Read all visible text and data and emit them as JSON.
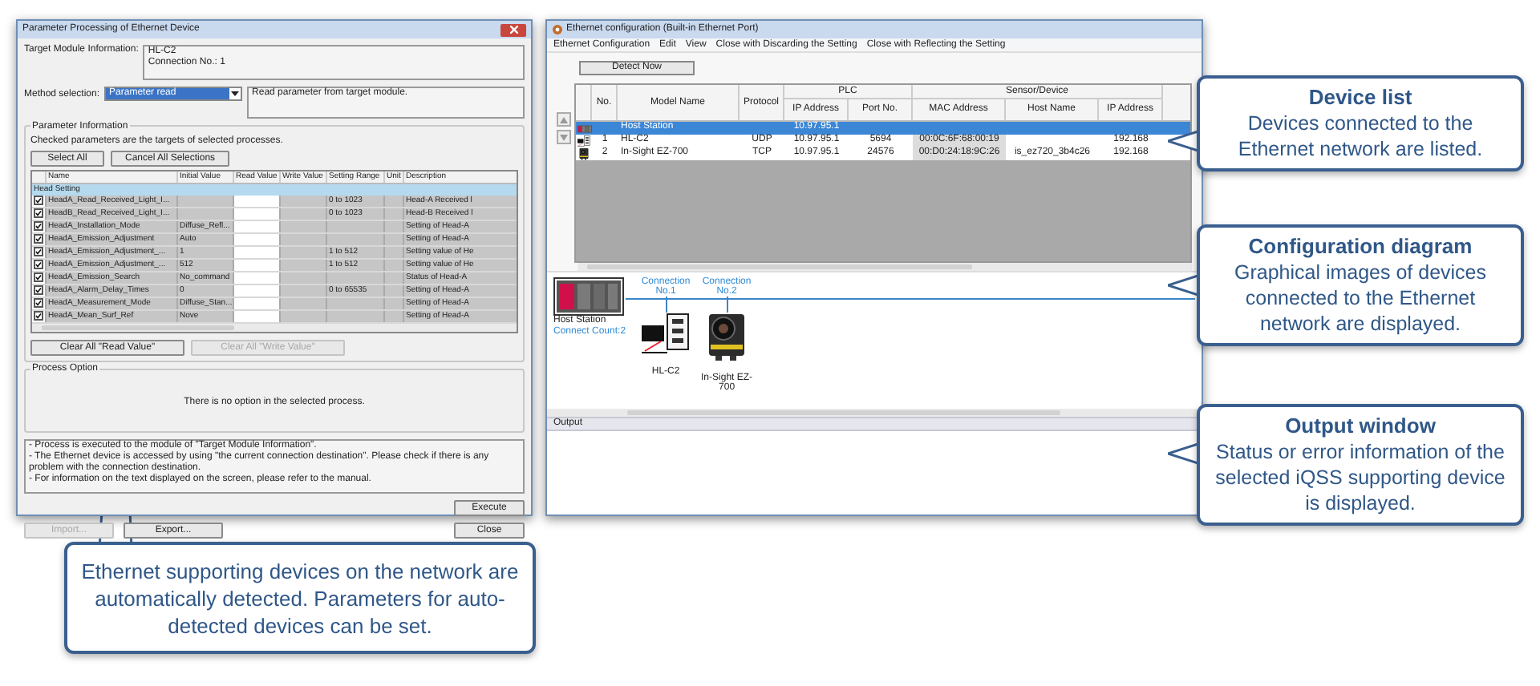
{
  "parameter_window": {
    "title": "Parameter Processing of Ethernet Device",
    "target_module_label": "Target Module Information:",
    "target_module_lines": [
      "HL-C2",
      "Connection No.: 1"
    ],
    "method_label": "Method selection:",
    "method_value": "Parameter read",
    "method_description": "Read parameter from target module.",
    "parameter_group_label": "Parameter Information",
    "parameter_hint": "Checked parameters are the targets of selected processes.",
    "selection_buttons": [
      {
        "label": "Select All",
        "disabled": false
      },
      {
        "label": "Cancel All Selections",
        "disabled": false
      }
    ],
    "columns": [
      "Name",
      "Initial Value",
      "Read Value",
      "Write Value",
      "Setting Range",
      "Unit",
      "Description"
    ],
    "group_row": "Head Setting",
    "rows": [
      {
        "checked": true,
        "cells": [
          "HeadA_Read_Received_Light_I...",
          "",
          "",
          "",
          "0 to 1023",
          "",
          "Head-A Received l"
        ]
      },
      {
        "checked": true,
        "cells": [
          "HeadB_Read_Received_Light_I...",
          "",
          "",
          "",
          "0 to 1023",
          "",
          "Head-B Received l"
        ]
      },
      {
        "checked": true,
        "cells": [
          "HeadA_Installation_Mode",
          "Diffuse_Refl...",
          "",
          "",
          "",
          "",
          "Setting of Head-A"
        ]
      },
      {
        "checked": true,
        "cells": [
          "HeadA_Emission_Adjustment",
          "Auto",
          "",
          "",
          "",
          "",
          "Setting of Head-A"
        ]
      },
      {
        "checked": true,
        "cells": [
          "HeadA_Emission_Adjustment_...",
          "1",
          "",
          "",
          "1 to 512",
          "",
          "Setting value of He"
        ]
      },
      {
        "checked": true,
        "cells": [
          "HeadA_Emission_Adjustment_...",
          "512",
          "",
          "",
          "1 to 512",
          "",
          "Setting value of He"
        ]
      },
      {
        "checked": true,
        "cells": [
          "HeadA_Emission_Search",
          "No_command",
          "",
          "",
          "",
          "",
          "Status of Head-A"
        ]
      },
      {
        "checked": true,
        "cells": [
          "HeadA_Alarm_Delay_Times",
          "0",
          "",
          "",
          "0 to 65535",
          "",
          "Setting of Head-A"
        ]
      },
      {
        "checked": true,
        "cells": [
          "HeadA_Measurement_Mode",
          "Diffuse_Stan...",
          "",
          "",
          "",
          "",
          "Setting of Head-A"
        ]
      },
      {
        "checked": true,
        "cells": [
          "HeadA_Mean_Surf_Ref",
          "Nove",
          "",
          "",
          "",
          "",
          "Setting of Head-A"
        ]
      }
    ],
    "clear_buttons": [
      {
        "label": "Clear All \"Read Value\"",
        "disabled": false
      },
      {
        "label": "Clear All \"Write Value\"",
        "disabled": true
      }
    ],
    "process_option_label": "Process Option",
    "process_option_text": "There is no option in the selected process.",
    "messages": [
      "- Process is executed to the module of \"Target Module Information\".",
      "- The Ethernet device is accessed by using \"the current connection destination\". Please check if there is any problem with the connection destination.",
      "- For information on the text displayed on the screen, please refer to the manual."
    ],
    "execute_button": {
      "label": "Execute",
      "disabled": false
    },
    "bottom_buttons": [
      {
        "label": "Import...",
        "disabled": true
      },
      {
        "label": "Export...",
        "disabled": false
      },
      {
        "label": "Close",
        "disabled": false
      }
    ]
  },
  "ethernet_window": {
    "title": "Ethernet configuration (Built-in Ethernet Port)",
    "menu": [
      "Ethernet Configuration",
      "Edit",
      "View",
      "Close with Discarding the Setting",
      "Close with Reflecting the Setting"
    ],
    "detect_button": "Detect Now",
    "column_groups": [
      "PLC",
      "Sensor/Device"
    ],
    "columns": [
      "No.",
      "Model Name",
      "Protocol",
      "IP Address",
      "Port No.",
      "MAC Address",
      "Host Name",
      "IP Address"
    ],
    "rows": [
      {
        "kind": "plc",
        "selected": true,
        "cells": [
          "",
          "Host Station",
          "",
          "10.97.95.1",
          "",
          "",
          "",
          ""
        ]
      },
      {
        "kind": "sensor",
        "selected": false,
        "cells": [
          "1",
          "HL-C2",
          "UDP",
          "10.97.95.1",
          "5694",
          "00:0C:6F:68:00:19",
          "",
          "192.168"
        ]
      },
      {
        "kind": "camera",
        "selected": false,
        "cells": [
          "2",
          "In-Sight EZ-700",
          "TCP",
          "10.97.95.1",
          "24576",
          "00:D0:24:18:9C:26",
          "is_ez720_3b4c26",
          "192.168"
        ]
      }
    ],
    "diagram": {
      "host_label": "Host Station",
      "host_count": "Connect Count:2",
      "devices": [
        {
          "kind": "sensor",
          "connection": "Connection No.1",
          "label": "HL-C2"
        },
        {
          "kind": "camera",
          "connection": "Connection No.2",
          "label": "In-Sight EZ-700"
        }
      ]
    },
    "output_label": "Output"
  },
  "callouts": [
    {
      "title": "Device list",
      "text": "Devices connected to the Ethernet network are listed."
    },
    {
      "title": "Configuration diagram",
      "text": "Graphical images of devices connected to the Ethernet network are displayed."
    },
    {
      "title": "Output window",
      "text": "Status or error information of the selected iQSS supporting device is displayed."
    }
  ],
  "bottom_callout": "Ethernet supporting devices on the network are automatically detected. Parameters for auto-detected devices can be set."
}
